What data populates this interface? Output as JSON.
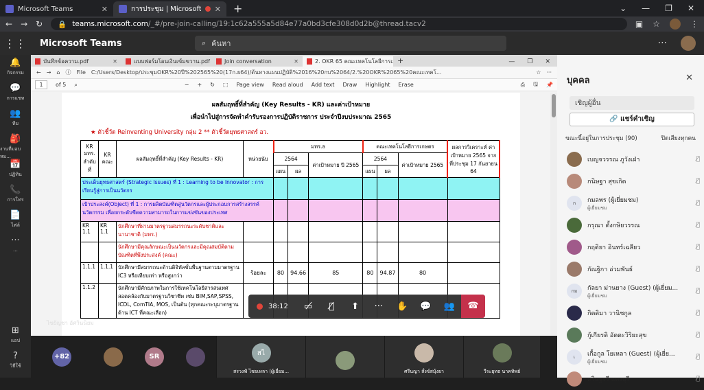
{
  "browser": {
    "tabs": [
      {
        "label": "Microsoft Teams",
        "active": false
      },
      {
        "label": "การประชุม | Microsoft Teams",
        "active": true
      }
    ],
    "url_host": "teams.microsoft.com",
    "url_path": "/_#/pre-join-calling/19:1c62a555a5d84e77a0bd3cfe308d0d2b@thread.tacv2"
  },
  "teams": {
    "brand": "Microsoft Teams",
    "search_placeholder": "ค้นหา"
  },
  "rail": [
    {
      "label": "กิจกรรม",
      "icon": "bell-icon"
    },
    {
      "label": "การแชท",
      "icon": "chat-icon"
    },
    {
      "label": "ทีม",
      "icon": "teams-icon"
    },
    {
      "label": "งานที่มอบหม...",
      "icon": "assignments-icon"
    },
    {
      "label": "ปฏิทิน",
      "icon": "calendar-icon"
    },
    {
      "label": "การโทร",
      "icon": "call-icon"
    },
    {
      "label": "ไฟล์",
      "icon": "file-icon"
    },
    {
      "label": "...",
      "icon": "more-icon"
    }
  ],
  "rail_bottom": [
    {
      "label": "แอป",
      "icon": "apps-icon"
    },
    {
      "label": "วิธีใช้",
      "icon": "help-icon"
    }
  ],
  "edge": {
    "tabs": [
      "บันทึกข้อความ.pdf",
      "แบบฟอร์มโอนเงินเข้มขวาน.pdf",
      "Join conversation",
      "2. OKR 65 คณะเทคโนโลยีการเกษตร"
    ],
    "file_label": "File",
    "path": "C:/Users/Desktop/ประชุมOKR%20ปี%202565%20(17ก.ย64)/ต้นทางแผนปฏิบัติ%2016%20กบ%2064/2.%20OKR%2065%20คณะเทคโ...",
    "pdf": {
      "page": "1",
      "of": "of 5",
      "page_view": "Page view",
      "read_aloud": "Read aloud",
      "add_text": "Add text",
      "draw": "Draw",
      "highlight": "Highlight",
      "erase": "Erase"
    }
  },
  "doc": {
    "title1": "ผลสัมฤทธิ์ที่สำคัญ (Key Results - KR) และค่าเป้าหมาย",
    "title2": "เพื่อนำไปสู่การจัดทำคำรับรองการปฏิบัติราชการ ประจำปีงบประมาณ 2565",
    "kpi_note": "★ ตัวชี้วัด Reinventing University กลุ่ม 2    ** ตัวชี้วัดยุทธศาสตร์ อว.",
    "h": {
      "kr_univ": "KR มทร. ลำดับที่",
      "kr_fac": "KR คณะ",
      "kr_title": "ผลสัมฤทธิ์ที่สำคัญ (Key Results - KR)",
      "unit": "หน่วยนับ",
      "univ": "มทร.ธ",
      "fac": "คณะเทคโนโลยีการเกษตร",
      "analysis": "ผลการวิเคราะห์ ค่าเป้าหมาย 2565 จากที่ประชุม 17 กันยายน 64",
      "y2564": "2564",
      "target2565": "ค่าเป้าหมาย ปี 2565",
      "target2565b": "ค่าเป้าหมาย 2565",
      "plan": "แผน",
      "result": "ผล"
    },
    "strategic": "ประเด็นยุทธศาสตร์ (Strategic Issues) ที่ 1 : Learning to be Innovator : การเรียนรู้สู่การเป็นนวัตกร",
    "objective": "เป้าประสงค์(Object) ที่ 1 : การผลิตบัณฑิตสู่นวัตกรและผู้ประกอบการสร้างสรรค์นวัตกรรม เพื่อยกระดับขีดความสามารถในการแข่งขันของประเทศ",
    "rows": [
      {
        "a": "KR 1.1",
        "b": "KR 1.1",
        "t": "นักศึกษาที่ผ่านมาตรฐานสมรรถนะระดับชาติและนานาชาติ (มทร.)",
        "red": true
      },
      {
        "a": "",
        "b": "",
        "t": "นักศึกษามีคุณลักษณะเป็นนวัตกรและมีคุณสมบัติตามบัณฑิตที่พึงประสงค์ (คณะ)",
        "red": true
      },
      {
        "a": "1.1.1",
        "b": "1.1.1",
        "t": "นักศึกษามีสมรรถนะด้านดิจิทัลขั้นพื้นฐานตามมาตรฐาน IC3 หรือเทียบเท่า หรือสูงกว่า",
        "unit": "ร้อยละ",
        "v": [
          "80",
          "94.66",
          "85",
          "80",
          "94.87",
          "80"
        ]
      },
      {
        "a": "1.1.2",
        "b": "",
        "t": "นักศึกษามีศักยภาพในการใช้เทคโนโลยีสารสนเทศสอดคล้องกับมาตรฐานวิชาชีพ เช่น BIM,SAP,SPSS, ICDL, ComTIA, MOS, เป็นต้น (ทุกคณะระบุมาตรฐานด้าน ICT ที่คณะเลือก)"
      }
    ]
  },
  "call": {
    "timer": "38:12",
    "self_name": "ไชยัญชา อัศวินนิยม"
  },
  "participants_strip": [
    {
      "type": "count",
      "label": "+82"
    },
    {
      "type": "video",
      "label": ""
    },
    {
      "type": "initials",
      "label": "SR"
    },
    {
      "type": "video",
      "label": ""
    },
    {
      "type": "initials",
      "label": "สไ",
      "name": "สรวงฟ้ ไชยเหลา (ผู้เยี่ยม..."
    },
    {
      "type": "video",
      "label": "",
      "name": ""
    },
    {
      "type": "video",
      "label": "",
      "name": "ศรีนญา สั่งข์สมุ้งยา"
    },
    {
      "type": "video",
      "label": "",
      "name": "วีระยุทธ นาคทิพย์"
    }
  ],
  "panel": {
    "title": "บุคคล",
    "invite_placeholder": "เชิญผู้อื่น",
    "share": "แชร์คำเชิญ",
    "section": "ขณะนี้อยู่ในการประชุม (90)",
    "mute_all": "ปิดเสียงทุกคน",
    "people": [
      {
        "name": "เบญจวรรณ ภูวังเฝ่า",
        "sub": ""
      },
      {
        "name": "กนิษฐา สุขเกิด",
        "sub": ""
      },
      {
        "name": "กมลพร (ผู้เยี่ยมชม)",
        "sub": "ผู้เยี่ยมชม",
        "init": "ก"
      },
      {
        "name": "กรุณา ตั้งกษิยวรรณ",
        "sub": ""
      },
      {
        "name": "กฤติยา อินทร์เฉลียว",
        "sub": ""
      },
      {
        "name": "กัณฐิกา อ่วมพันธ์",
        "sub": ""
      },
      {
        "name": "กัลยา ม่านยาง (Guest) (ผู้เยี่ยม...",
        "sub": "ผู้เยี่ยมชม",
        "init": "กม"
      },
      {
        "name": "กิตติมา วานิชกูล",
        "sub": ""
      },
      {
        "name": "กู้เกียรติ อัตตะวิริยะสุข",
        "sub": ""
      },
      {
        "name": "เกื้อกูล โยเหลา (Guest) (ผู้เยี่ย...",
        "sub": "ผู้เยี่ยมชม",
        "init": "เ"
      },
      {
        "name": "คริษฐจรี แดงบุรี",
        "sub": ""
      }
    ]
  }
}
